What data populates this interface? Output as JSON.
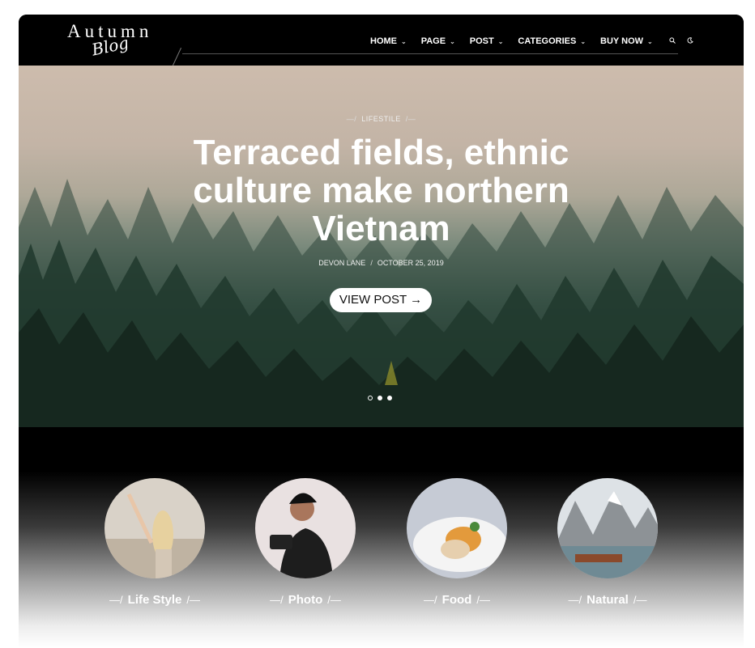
{
  "brand": {
    "logo_main": "Autumn",
    "logo_script": "Blog"
  },
  "nav": {
    "items": [
      {
        "label": "HOME"
      },
      {
        "label": "PAGE"
      },
      {
        "label": "POST"
      },
      {
        "label": "CATEGORIES"
      },
      {
        "label": "BUY NOW"
      }
    ],
    "icons": [
      "search-icon",
      "moon-icon"
    ]
  },
  "hero": {
    "category": "LIFESTILE",
    "title": "Terraced fields, ethnic culture make northern Vietnam",
    "author": "DEVON LANE",
    "meta_separator": "/",
    "date": "OCTOBER 25, 2019",
    "button_label": "VIEW POST",
    "slides": {
      "count": 3,
      "active_index": 0
    }
  },
  "categories": [
    {
      "label": "Life Style"
    },
    {
      "label": "Photo"
    },
    {
      "label": "Food"
    },
    {
      "label": "Natural"
    }
  ],
  "colors": {
    "header_bg": "#000000",
    "text": "#ffffff"
  }
}
